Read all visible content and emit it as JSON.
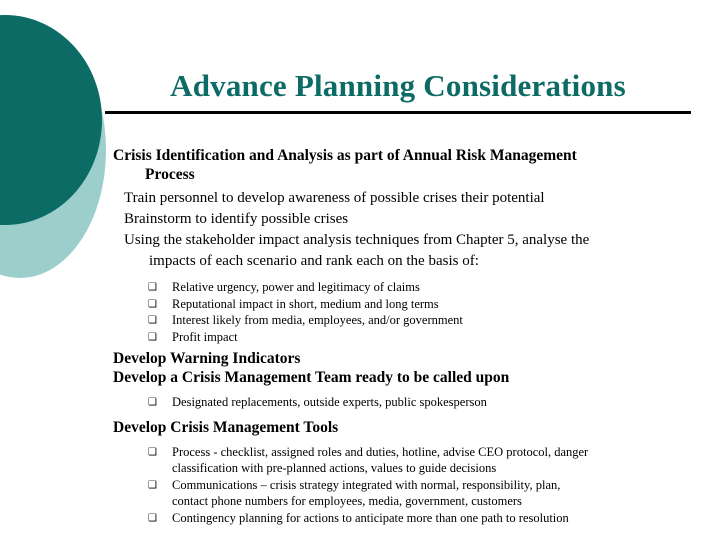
{
  "slide": {
    "title": "Advance Planning Considerations",
    "colors": {
      "title_teal": "#0d6b66",
      "ellipse_dark": "#0d6b66",
      "ellipse_light": "#9ccfcc",
      "rule_black": "#000000",
      "body_text": "#000000",
      "background": "#ffffff"
    },
    "bullet_glyph": "❑"
  },
  "content": {
    "heading_1": {
      "line_a": "Crisis Identification and Analysis as part of Annual Risk Management",
      "line_b": "Process"
    },
    "level2_a": [
      {
        "text": "Train personnel to develop awareness of possible crises their potential"
      },
      {
        "text": "Brainstorm to identify possible crises"
      },
      {
        "text": "Using the stakeholder impact analysis techniques from Chapter 5, analyse the",
        "wrap": "impacts of each scenario and rank each on the basis of:"
      }
    ],
    "level3_a": [
      {
        "text": "Relative urgency, power and legitimacy of claims"
      },
      {
        "text": "Reputational impact in short, medium and long terms"
      },
      {
        "text": "Interest likely from media, employees, and/or government"
      },
      {
        "text": "Profit impact"
      }
    ],
    "heading_2": "Develop Warning Indicators",
    "heading_3": "Develop a Crisis Management Team ready to be called upon",
    "level3_b": [
      {
        "text": "Designated replacements, outside experts, public spokesperson"
      }
    ],
    "heading_4": "Develop Crisis Management Tools",
    "level3_c": [
      {
        "text": "Process - checklist, assigned roles and duties, hotline, advise CEO protocol, danger",
        "wrap": "classification with pre-planned actions, values to guide decisions"
      },
      {
        "text": "Communications – crisis strategy integrated with normal, responsibility, plan,",
        "wrap": "contact phone numbers for employees, media, government, customers"
      },
      {
        "text": "Contingency planning for actions to anticipate more than one path to resolution"
      }
    ]
  }
}
